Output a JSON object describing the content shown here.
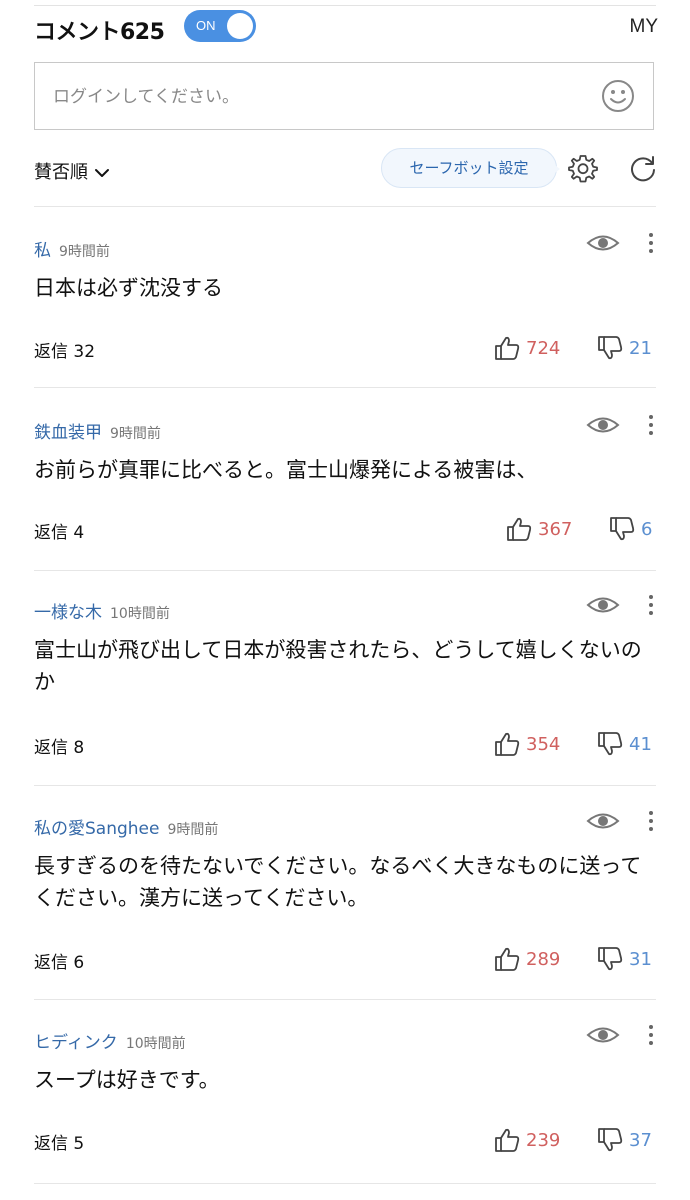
{
  "header": {
    "comment_label": "コメント625",
    "toggle_label": "ON",
    "my_label": "MY"
  },
  "input": {
    "placeholder": "ログインしてください。"
  },
  "sort_bar": {
    "sort_label": "賛否順",
    "safebot_label": "セーフボット設定"
  },
  "comments": [
    {
      "author": "私",
      "time": "9時間前",
      "text": "日本は必ず沈没する",
      "reply_label": "返信 32",
      "likes": "724",
      "dislikes": "21"
    },
    {
      "author": "鉄血装甲",
      "time": "9時間前",
      "text": "お前らが真罪に比べると。富士山爆発による被害は、",
      "reply_label": "返信 4",
      "likes": "367",
      "dislikes": "6"
    },
    {
      "author": "一様な木",
      "time": "10時間前",
      "text": "富士山が飛び出して日本が殺害されたら、どうして嬉しくないのか",
      "reply_label": "返信 8",
      "likes": "354",
      "dislikes": "41"
    },
    {
      "author": "私の愛Sanghee",
      "time": "9時間前",
      "text": "長すぎるのを待たないでください。なるべく大きなものに送ってください。漢方に送ってください。",
      "reply_label": "返信 6",
      "likes": "289",
      "dislikes": "31"
    },
    {
      "author": "ヒディンク",
      "time": "10時間前",
      "text": "スープは好きです。",
      "reply_label": "返信 5",
      "likes": "239",
      "dislikes": "37"
    }
  ],
  "colors": {
    "accent": "#4a90e2",
    "author": "#3569a8",
    "like": "#d0605f",
    "dislike": "#5b8fd0"
  }
}
